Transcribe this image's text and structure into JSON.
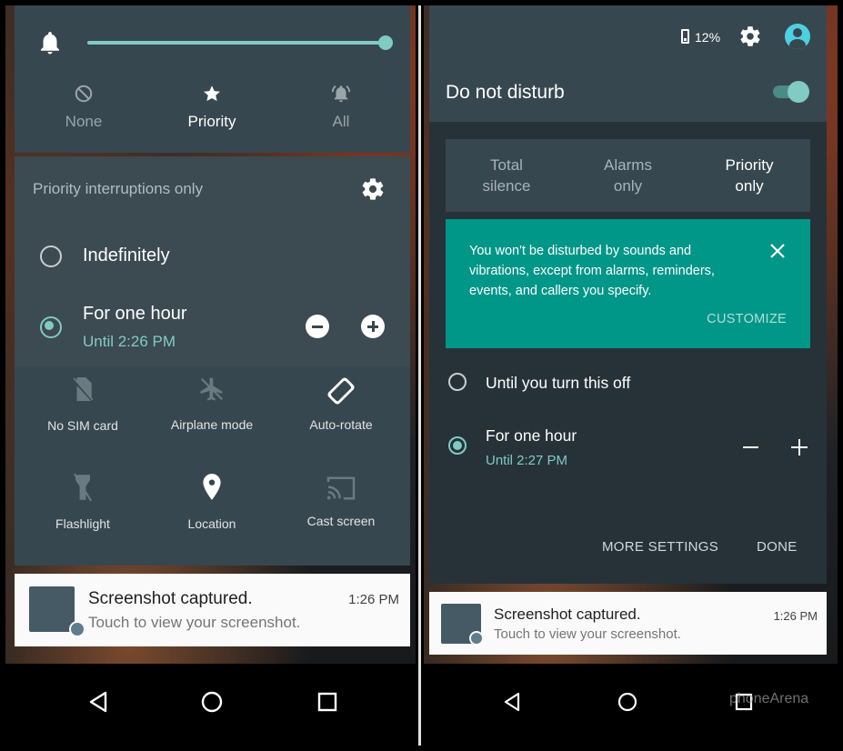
{
  "left": {
    "modes": [
      {
        "icon": "none-icon",
        "label": "None"
      },
      {
        "icon": "star-icon",
        "label": "Priority"
      },
      {
        "icon": "bell-icon",
        "label": "All"
      }
    ],
    "header": "Priority interruptions only",
    "option1": "Indefinitely",
    "option2": {
      "title": "For one hour",
      "subtitle": "Until 2:26 PM"
    },
    "tiles": [
      {
        "icon": "no-sim-icon",
        "label": "No SIM card"
      },
      {
        "icon": "airplane-icon",
        "label": "Airplane mode"
      },
      {
        "icon": "auto-rotate-icon",
        "label": "Auto-rotate"
      },
      {
        "icon": "flashlight-icon",
        "label": "Flashlight"
      },
      {
        "icon": "location-icon",
        "label": "Location"
      },
      {
        "icon": "cast-icon",
        "label": "Cast screen"
      }
    ],
    "notification": {
      "title": "Screenshot captured.",
      "text": "Touch to view your screenshot.",
      "time": "1:26 PM"
    }
  },
  "right": {
    "battery": "12%",
    "title": "Do not disturb",
    "tabs": [
      {
        "l1": "Total",
        "l2": "silence"
      },
      {
        "l1": "Alarms",
        "l2": "only"
      },
      {
        "l1": "Priority",
        "l2": "only"
      }
    ],
    "info_text": "You won't be disturbed by sounds and vibrations, except from alarms, reminders, events, and callers you specify.",
    "customize": "CUSTOMIZE",
    "option1": "Until you turn this off",
    "option2": {
      "title": "For one hour",
      "subtitle": "Until 2:27 PM"
    },
    "more_settings": "MORE SETTINGS",
    "done": "DONE",
    "notification": {
      "title": "Screenshot captured.",
      "text": "Touch to view your screenshot.",
      "time": "1:26 PM"
    }
  },
  "watermark": "phoneArena",
  "colors": {
    "accent": "#80cbc4",
    "panel": "#37474f",
    "card": "#009688"
  }
}
